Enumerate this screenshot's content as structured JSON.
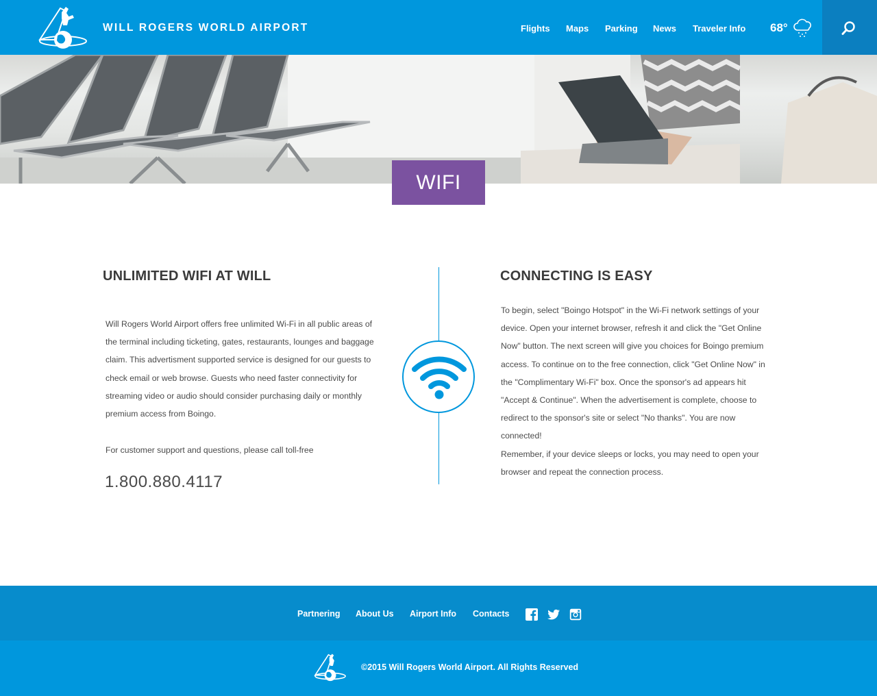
{
  "header": {
    "site_title": "WILL ROGERS WORLD AIRPORT",
    "nav": [
      "Flights",
      "Maps",
      "Parking",
      "News",
      "Traveler Info"
    ],
    "temperature": "68°",
    "weather_icon": "snow-cloud-icon",
    "search_icon": "search-icon"
  },
  "hero": {
    "badge": "WIFI"
  },
  "left": {
    "heading": "UNLIMITED WIFI AT WILL",
    "intro": "Will Rogers World Airport offers free unlimited Wi-Fi in all public areas of the terminal including ticketing, gates, restaurants, lounges and baggage claim. This advertisment supported service is designed for our guests to check email or web browse. Guests who need faster connectivity for streaming video or audio should consider purchasing daily or monthly premium access from Boingo.",
    "support": "For customer support and questions, please call toll-free",
    "phone": "1.800.880.4117"
  },
  "right": {
    "heading": "CONNECTING IS EASY",
    "steps": "To begin, select \"Boingo Hotspot\" in the Wi-Fi network settings of your device. Open your internet browser, refresh it and click the \"Get Online Now\" button. The next screen will give you choices for Boingo premium access. To continue on to the free connection, click \"Get Online Now\" in the \"Complimentary Wi-Fi\" box. Once the sponsor's ad appears hit \"Accept & Continue\". When the advertisement is complete, choose to redirect to the sponsor's site or select \"No thanks\". You are now connected!",
    "reminder": "Remember, if your device sleeps or locks, you may need to open your browser and repeat the connection process."
  },
  "footer": {
    "links": [
      "Partnering",
      "About Us",
      "Airport Info",
      "Contacts"
    ],
    "social_icons": [
      "facebook-icon",
      "twitter-icon",
      "instagram-icon"
    ],
    "copyright": "©2015 Will Rogers World Airport. All Rights Reserved"
  },
  "colors": {
    "brand_blue": "#0097dd",
    "footer_dark_blue": "#078ccc",
    "badge_purple": "#7b52a0"
  }
}
